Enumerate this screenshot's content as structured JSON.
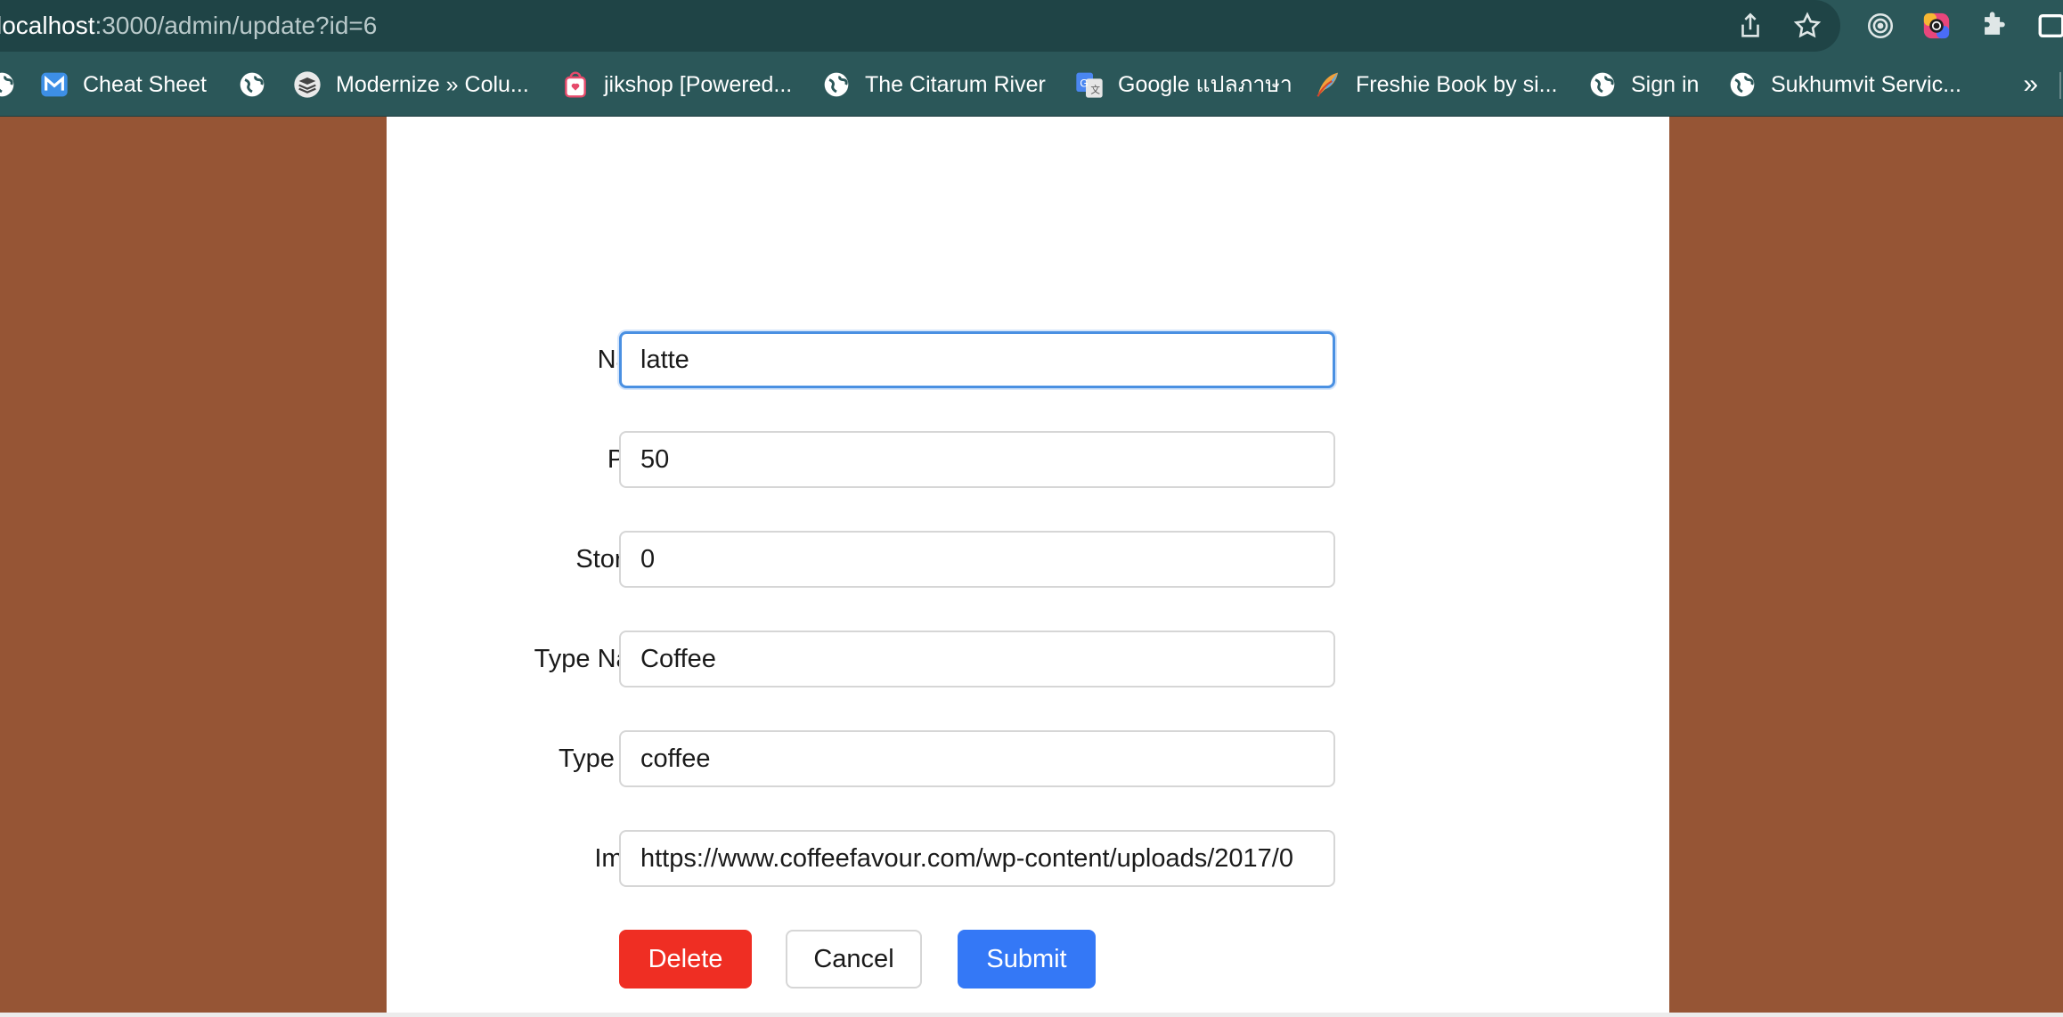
{
  "browser": {
    "url_host": "localhost",
    "url_path": ":3000/admin/update?id=6"
  },
  "bookmarks": {
    "items": [
      {
        "label": "Cheat Sheet",
        "icon": "m-logo-icon"
      },
      {
        "label": "Modernize » Colu...",
        "icon": "stack-icon"
      },
      {
        "label": "jikshop [Powered...",
        "icon": "shop-bag-icon"
      },
      {
        "label": "The Citarum River",
        "icon": "globe-icon"
      },
      {
        "label": "Google แปลภาษา",
        "icon": "google-translate-icon"
      },
      {
        "label": "Freshie Book by si...",
        "icon": "feather-icon"
      },
      {
        "label": "Sign in",
        "icon": "globe-icon"
      },
      {
        "label": "Sukhumvit Servic...",
        "icon": "globe-icon"
      }
    ],
    "more_label": "»"
  },
  "form": {
    "fields": [
      {
        "label": "Name",
        "value": "latte"
      },
      {
        "label": "Price",
        "value": "50"
      },
      {
        "label": "Storage",
        "value": "0"
      },
      {
        "label": "Type Name",
        "value": "Coffee"
      },
      {
        "label": "Type Key",
        "value": "coffee"
      },
      {
        "label": "Image",
        "value": "https://www.coffeefavour.com/wp-content/uploads/2017/0"
      }
    ],
    "colon": ":",
    "buttons": {
      "delete": "Delete",
      "cancel": "Cancel",
      "submit": "Submit"
    }
  },
  "colors": {
    "page_background": "#965535",
    "delete": "#ef2e23",
    "submit": "#3478f6",
    "browser_bar": "#2b5759"
  }
}
